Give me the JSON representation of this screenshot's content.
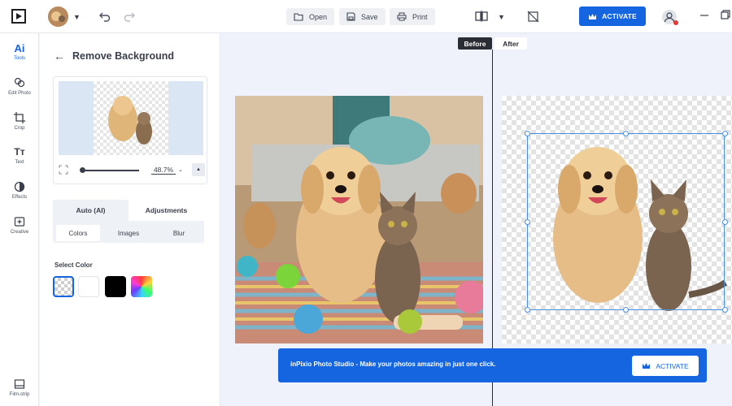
{
  "toolbar": {
    "open_label": "Open",
    "save_label": "Save",
    "print_label": "Print",
    "activate_label": "ACTIVATE"
  },
  "rail": {
    "items": [
      {
        "label": "Tools",
        "icon": "ai-icon"
      },
      {
        "label": "Edit Photo",
        "icon": "edit-photo-icon"
      },
      {
        "label": "Crop",
        "icon": "crop-icon"
      },
      {
        "label": "Text",
        "icon": "text-icon"
      },
      {
        "label": "Effects",
        "icon": "effects-icon"
      },
      {
        "label": "Creative",
        "icon": "creative-icon"
      }
    ],
    "bottom_label": "Film-strip"
  },
  "panel": {
    "title": "Remove Background",
    "zoom": "48.7%",
    "tabs": [
      "Auto (AI)",
      "Adjustments"
    ],
    "subtabs": [
      "Colors",
      "Images",
      "Blur"
    ],
    "select_color_label": "Select Color"
  },
  "canvas": {
    "before_label": "Before",
    "after_label": "After"
  },
  "promo": {
    "text": "inPixio Photo Studio - Make your photos amazing in just one click.",
    "button_label": "ACTIVATE"
  },
  "colors": {
    "accent": "#1565e0",
    "swatches": [
      "transparent",
      "#ffffff",
      "#000000",
      "rainbow"
    ]
  }
}
